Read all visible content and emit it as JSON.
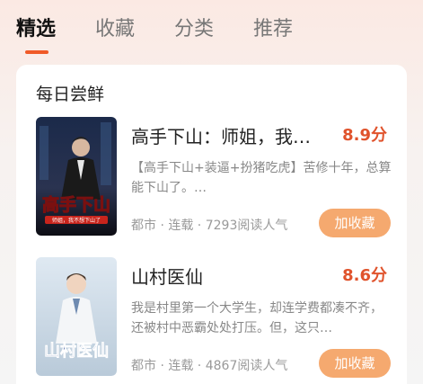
{
  "tabs": [
    {
      "label": "精选",
      "active": true
    },
    {
      "label": "收藏",
      "active": false
    },
    {
      "label": "分类",
      "active": false
    },
    {
      "label": "推荐",
      "active": false
    }
  ],
  "section": {
    "title": "每日尝鲜"
  },
  "books": [
    {
      "title": "高手下山：师姐，我…",
      "score": "8.9分",
      "desc": "【高手下山+装逼+扮猪吃虎】苦修十年，总算能下山了。…",
      "genre": "都市",
      "status": "连载",
      "readers": "7293阅读人气",
      "button": "加收藏",
      "cover_text": "高手下山",
      "cover_sub": "师姐，我不想下山了"
    },
    {
      "title": "山村医仙",
      "score": "8.6分",
      "desc": "我是村里第一个大学生，却连学费都凑不齐，还被村中恶霸处处打压。但，这只…",
      "genre": "都市",
      "status": "连载",
      "readers": "4867阅读人气",
      "button": "加收藏",
      "cover_text": "山村医仙"
    }
  ],
  "colors": {
    "accent": "#f05a28",
    "score": "#e0532c",
    "button": "#f5a96f"
  }
}
